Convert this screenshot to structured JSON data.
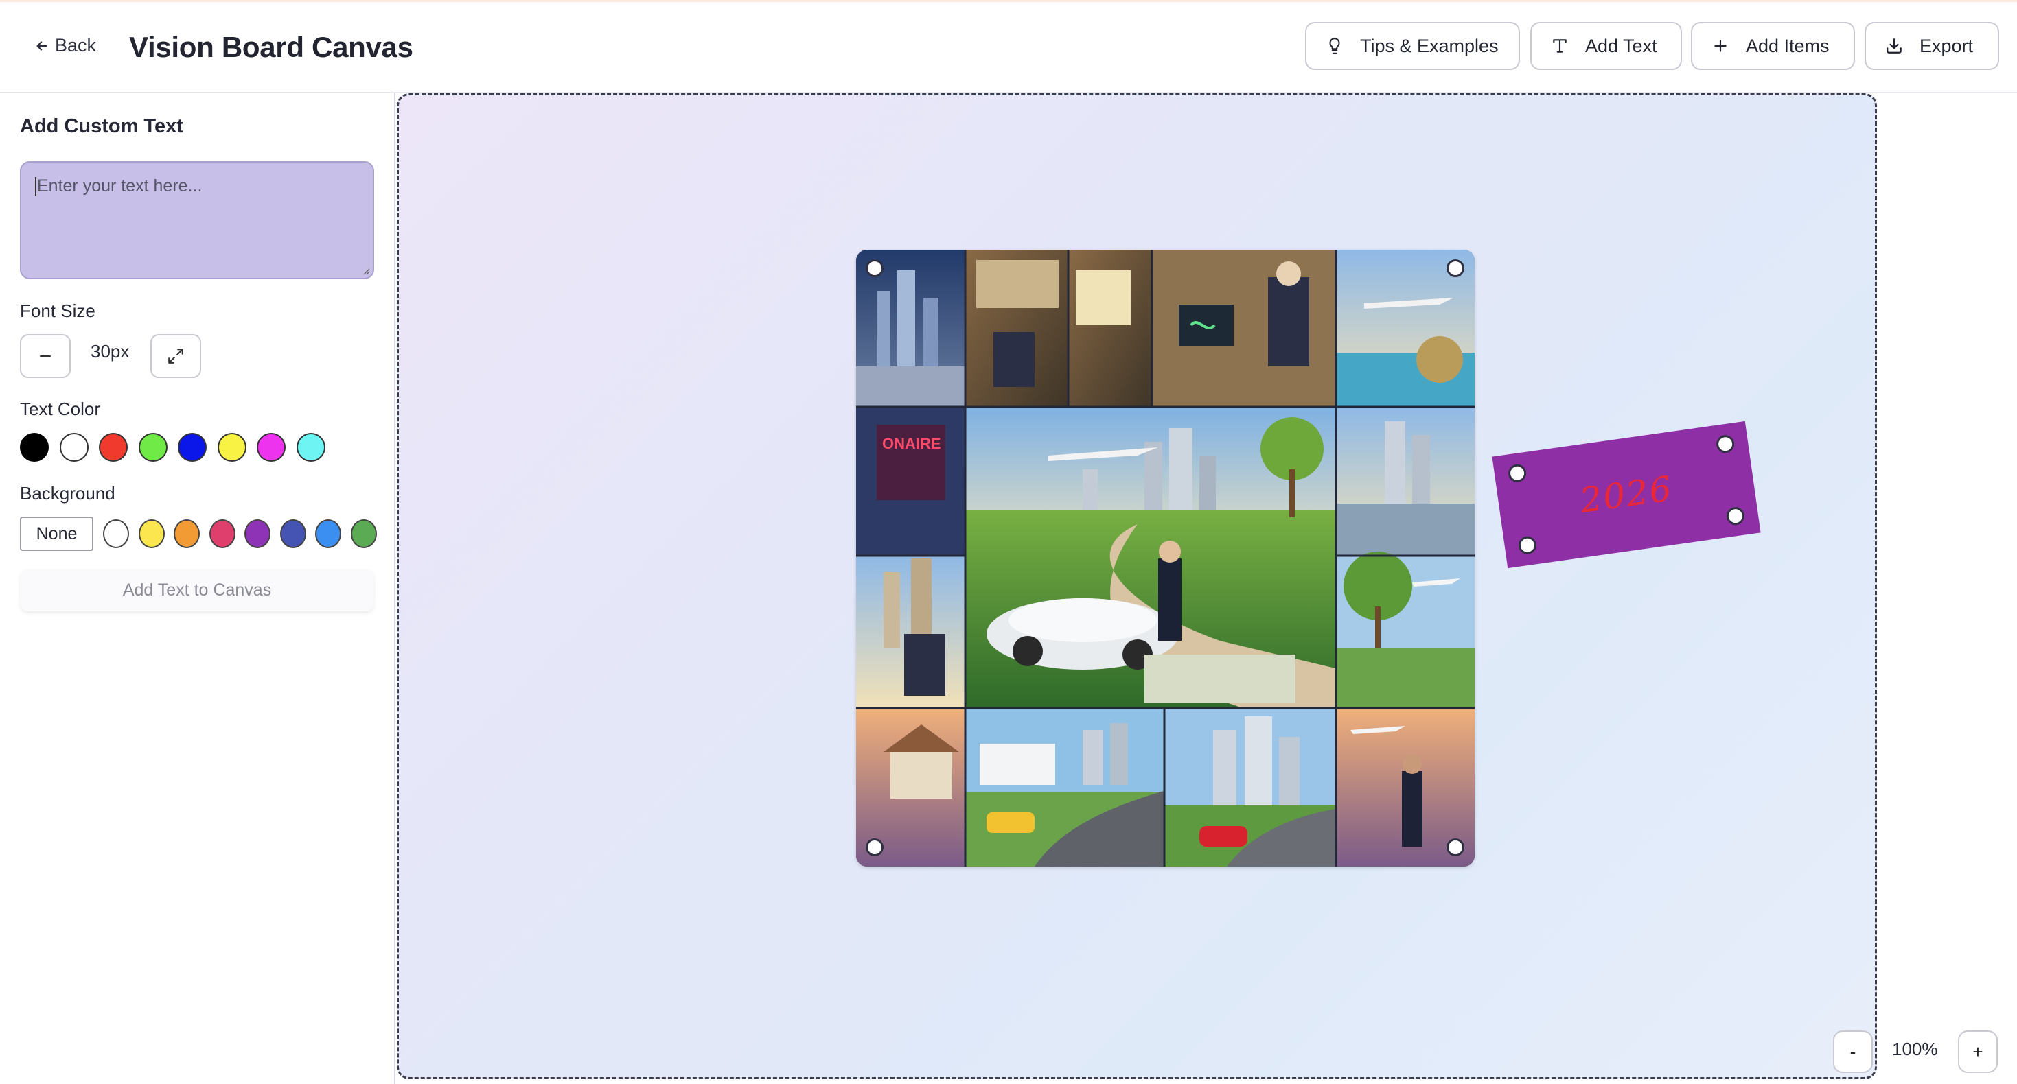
{
  "header": {
    "back_label": "Back",
    "title": "Vision Board Canvas",
    "buttons": {
      "tips": "Tips & Examples",
      "add_text": "Add Text",
      "add_items": "Add Items",
      "export": "Export"
    }
  },
  "sidebar": {
    "title": "Add Custom Text",
    "text_input": {
      "placeholder": "Enter your text here...",
      "value": ""
    },
    "font_size": {
      "label": "Font Size",
      "value": "30px"
    },
    "text_color": {
      "label": "Text Color",
      "options": [
        "#000000",
        "#ffffff",
        "#f03a2e",
        "#6fea47",
        "#0a17e8",
        "#f8f244",
        "#ee33ee",
        "#6ef5f3"
      ]
    },
    "background": {
      "label": "Background",
      "none_label": "None",
      "options": [
        "#ffffff",
        "#fbe64f",
        "#f29a34",
        "#de3f6c",
        "#8e33b5",
        "#4553b3",
        "#3b8ff0",
        "#5bab54"
      ]
    },
    "add_button_label": "Add Text to Canvas"
  },
  "canvas": {
    "image_item": {
      "icon": "vision-collage-image"
    },
    "text_item": {
      "text": "2026",
      "text_color": "#e8283a",
      "background_color": "#8e2fa6"
    }
  },
  "zoom": {
    "minus_label": "-",
    "plus_label": "+",
    "value": "100%"
  }
}
